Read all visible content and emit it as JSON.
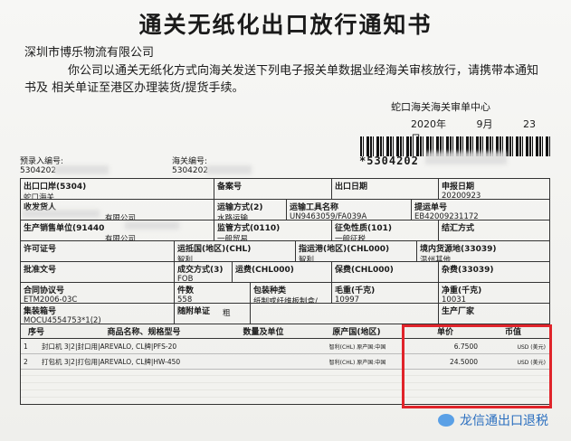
{
  "title": "通关无纸化出口放行通知书",
  "company": "深圳市博乐物流有限公司",
  "paragraph": "你公司以通关无纸化方式向海关发送下列电子报关单数据业经海关审核放行，请携带本通知书及 相关单证至港区办理装货/提货手续。",
  "customs_center": "蛇口海关海关审单中心",
  "date": {
    "year": "2020年",
    "month": "9月",
    "day": "23日"
  },
  "barcode_text": "*5304202",
  "pre_entry": {
    "label": "预录入编号:",
    "value": "5304202"
  },
  "customs_no": {
    "label": "海关编号:",
    "value": "5304202"
  },
  "rows": {
    "r1": [
      {
        "label": "出口口岸(5304)",
        "value": "蛇口海关"
      },
      {
        "label": "备案号",
        "value": ""
      },
      {
        "label": "出口日期",
        "value": ""
      },
      {
        "label": "申报日期",
        "value": "20200923"
      }
    ],
    "r2": [
      {
        "label": "收发货人",
        "value": "有限公司"
      },
      {
        "label": "运输方式(2)",
        "value": "水路运输"
      },
      {
        "label": "运输工具名称",
        "value": "UN9463059/FA039A"
      },
      {
        "label": "提运单号",
        "value": "EB42009231172"
      }
    ],
    "r3": [
      {
        "label": "生产销售单位(91440",
        "value": "有限公司"
      },
      {
        "label": "监管方式(0110)",
        "value": "一般贸易"
      },
      {
        "label": "征免性质(101)",
        "value": "一般征税"
      },
      {
        "label": "结汇方式",
        "value": ""
      }
    ],
    "r4": [
      {
        "label": "许可证号",
        "value": ""
      },
      {
        "label": "运抵国(地区)(CHL)",
        "value": "智利"
      },
      {
        "label": "指运港(地区)(CHL000)",
        "value": "智利"
      },
      {
        "label": "境内货源地(33039)",
        "value": "温州其他"
      }
    ],
    "r5": [
      {
        "label": "批准文号",
        "value": ""
      },
      {
        "label": "成交方式(3)",
        "value": "FOB"
      },
      {
        "label": "运费(CHL000)",
        "value": ""
      },
      {
        "label": "保费(CHL000)",
        "value": ""
      },
      {
        "label": "杂费(33039)",
        "value": ""
      }
    ],
    "r6": [
      {
        "label": "合同协议号",
        "value": "ETM2006-03C"
      },
      {
        "label": "件数",
        "value": "558"
      },
      {
        "label": "包装种类",
        "value": "纸制或纤维板制盒/"
      },
      {
        "label": "毛重(千克)",
        "value": "10997"
      },
      {
        "label": "净重(千克)",
        "value": "10031"
      }
    ],
    "r7": [
      {
        "label": "集装箱号",
        "value": "MOCU4554753*1(2)"
      },
      {
        "label": "随附单证",
        "value": "粗"
      },
      {
        "label": "",
        "value": ""
      },
      {
        "label": "生产厂家",
        "value": ""
      }
    ]
  },
  "items_header": [
    "序号",
    "商品名称、规格型号",
    "数量及单位",
    "原产国(地区)",
    "单价",
    "币值"
  ],
  "items": [
    {
      "no": "1",
      "name": "封口机 3|2|封口用|AREVALO, CL牌|PFS-20",
      "qty": "",
      "origin": "智利(CHL) 原产国:中国",
      "price": "6.7500",
      "currency": "USD (美元)"
    },
    {
      "no": "2",
      "name": "打包机 3|2|打包用|AREVALO, CL牌|HW-450",
      "qty": "",
      "origin": "智利(CHL) 原产国:中国",
      "price": "24.5000",
      "currency": "USD (美元)"
    }
  ],
  "watermark": "龙信通出口退税",
  "colors": {
    "highlight": "#e0242a",
    "watermark": "#2b6fbf"
  }
}
